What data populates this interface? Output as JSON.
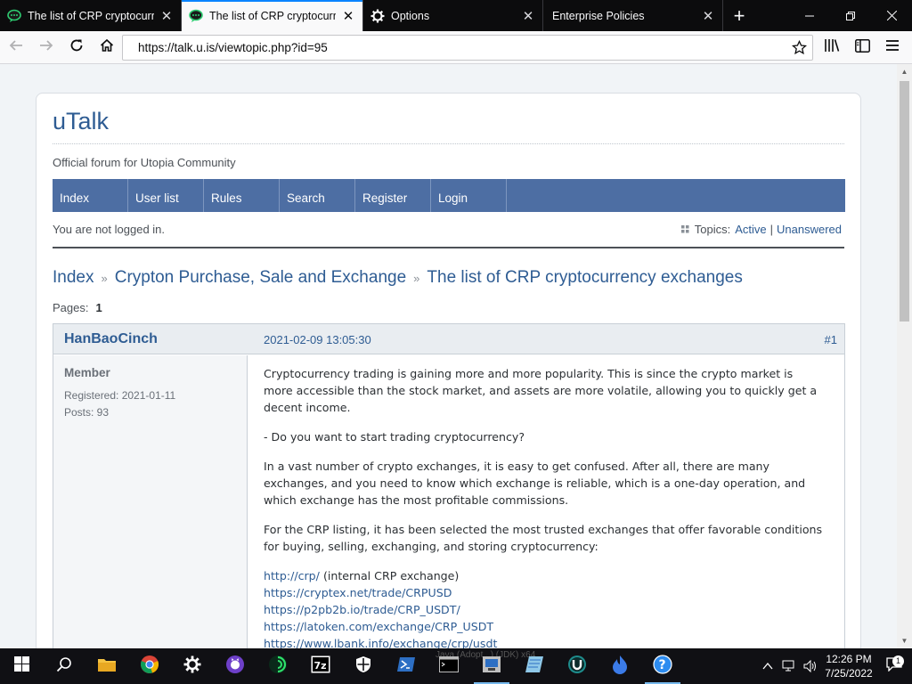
{
  "browser": {
    "tabs": [
      {
        "label": "The list of CRP cryptocurrency exchanges",
        "icon": "utopia-icon",
        "active": false
      },
      {
        "label": "The list of CRP cryptocurrency exchanges",
        "icon": "utopia-icon",
        "active": true
      },
      {
        "label": "Options",
        "icon": "gear-icon",
        "active": false
      },
      {
        "label": "Enterprise Policies",
        "icon": "",
        "active": false
      }
    ],
    "url": "https://talk.u.is/viewtopic.php?id=95"
  },
  "forum": {
    "title": "uTalk",
    "description": "Official forum for Utopia Community",
    "menu": [
      "Index",
      "User list",
      "Rules",
      "Search",
      "Register",
      "Login"
    ],
    "status": "You are not logged in.",
    "topics_label": "Topics:",
    "topics_active": "Active",
    "topics_sep": "|",
    "topics_unanswered": "Unanswered",
    "breadcrumb": [
      "Index",
      "Crypton Purchase, Sale and Exchange",
      "The list of CRP cryptocurrency exchanges"
    ],
    "breadcrumb_sep": "»",
    "pages_label": "Pages:",
    "pages_value": "1"
  },
  "post": {
    "author": "HanBaoCinch",
    "date": "2021-02-09 13:05:30",
    "number": "#1",
    "role": "Member",
    "registered": "Registered: 2021-01-11",
    "posts": "Posts: 93",
    "paragraphs": [
      "Cryptocurrency trading is gaining more and more popularity. This is since the crypto market is more accessible than the stock market, and assets are more volatile, allowing you to quickly get a decent income.",
      "- Do you want to start trading cryptocurrency?",
      "In a vast number of crypto exchanges, it is easy to get confused. After all, there are many exchanges, and you need to know which exchange is reliable, which is a one-day operation, and which exchange has the most profitable commissions.",
      "For the CRP listing, it has been selected the most trusted exchanges that offer favorable conditions for buying, selling, exchanging, and storing cryptocurrency:"
    ],
    "links": [
      {
        "url": "http://crp/",
        "note": "(internal CRP exchange)"
      },
      {
        "url": "https://cryptex.net/trade/CRPUSD",
        "note": ""
      },
      {
        "url": "https://p2pb2b.io/trade/CRP_USDT/",
        "note": ""
      },
      {
        "url": "https://latoken.com/exchange/CRP_USDT",
        "note": ""
      },
      {
        "url": "https://www.lbank.info/exchange/crp/usdt",
        "note": ""
      }
    ]
  },
  "taskbar": {
    "time": "12:26 PM",
    "date": "7/25/2022",
    "notification_count": "1",
    "ghost_text": "Java (Adopt...) (JDK) x64"
  }
}
